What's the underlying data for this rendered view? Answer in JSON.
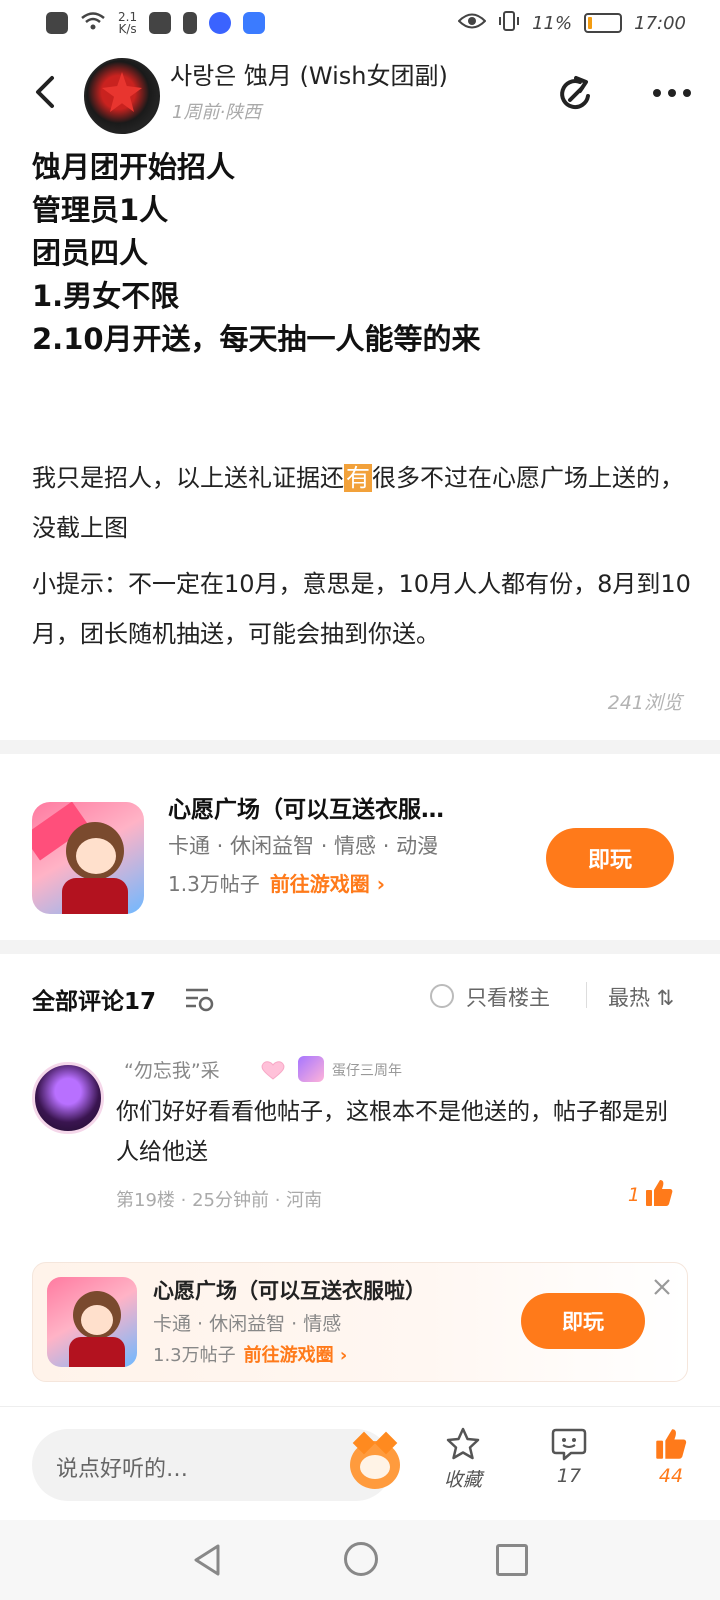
{
  "status_bar": {
    "net_speed_top": "2.1",
    "net_speed_bottom": "K/s",
    "battery_percent": "11%",
    "battery_level": 0.11,
    "time": "17:00"
  },
  "header": {
    "author_name": "사랑은 蚀月 (Wish女团副)",
    "author_meta": "1周前·陕西",
    "back_icon": "chevron-left-icon",
    "share_icon": "share-icon",
    "more_icon": "more-icon"
  },
  "post": {
    "title_lines": [
      "蚀月团开始招人",
      "管理员1人",
      "团员四人",
      "1.男女不限",
      "2.10月开送，每天抽一人能等的来"
    ],
    "body_p1_before": "我只是招人，以上送礼证据还",
    "body_p1_highlight": "有",
    "body_p1_after": "很多不过在心愿广场上送的，没截上图",
    "body_p2": "小提示：不一定在10月，意思是，10月人人都有份，8月到10月，团长随机抽送，可能会抽到你送。",
    "views": "241浏览"
  },
  "game_card": {
    "title": "心愿广场（可以互送衣服…",
    "tags": "卡通 · 休闲益智 · 情感 · 动漫",
    "posts": "1.3万帖子",
    "link": "前往游戏圈 ›",
    "play_label": "即玩"
  },
  "comments": {
    "title": "全部评论17",
    "only_author": "只看楼主",
    "sort": "最热 ⇅",
    "items": [
      {
        "name": "“勿忘我”采",
        "badge": "蛋仔三周年",
        "text": "你们好好看看他帖子，这根本不是他送的，帖子都是别人给他送",
        "meta": "第19楼 · 25分钟前 · 河南",
        "likes": "1"
      }
    ]
  },
  "ad_card": {
    "title": "心愿广场（可以互送衣服啦）",
    "tags": "卡通 · 休闲益智 · 情感",
    "posts": "1.3万帖子",
    "link": "前往游戏圈 ›",
    "play_label": "即玩",
    "close_icon": "close-icon"
  },
  "bottom_bar": {
    "input_placeholder": "说点好听的…",
    "favorite_label": "收藏",
    "comment_count": "17",
    "like_count": "44"
  },
  "colors": {
    "accent": "#ff7a1a",
    "highlight": "#f2a13a"
  }
}
